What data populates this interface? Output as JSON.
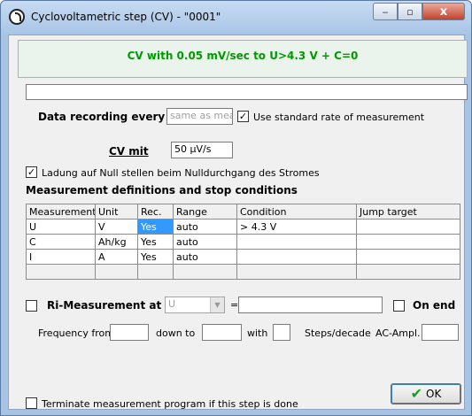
{
  "window": {
    "title": "Cyclovoltametric step (CV) - \"0001\"",
    "minimize_glyph": "‒",
    "maximize_glyph": "▫",
    "close_glyph": "x"
  },
  "banner": {
    "text": "CV with 0.05 mV/sec to U>4.3 V + C=0"
  },
  "recording": {
    "label": "Data recording every",
    "input_value": "same as meas",
    "std_rate_checkbox": "✓",
    "std_rate_label": "Use standard rate of measurement"
  },
  "cv": {
    "label": "CV mit",
    "value": "50 µV/s"
  },
  "ladung": {
    "checkbox": "✓",
    "label": "Ladung auf Null stellen beim Nulldurchgang des Stromes"
  },
  "definitions": {
    "heading": "Measurement definitions and stop conditions",
    "columns": [
      "Measurement u",
      "Unit",
      "Rec.",
      "Range",
      "Condition",
      "Jump target"
    ],
    "rows": [
      [
        "U",
        "V",
        "Yes",
        "auto",
        "> 4.3 V",
        ""
      ],
      [
        "C",
        "Ah/kg",
        "Yes",
        "auto",
        "",
        ""
      ],
      [
        "I",
        "A",
        "Yes",
        "auto",
        "",
        ""
      ],
      [
        "",
        "",
        "",
        "",
        "",
        ""
      ]
    ]
  },
  "ri": {
    "label": "Ri-Measurement at",
    "select_value": "U",
    "equals": "=",
    "on_end_label": "On end"
  },
  "frequency": {
    "from_label": "Frequency from",
    "down_to_label": "down to",
    "with_label": "with",
    "steps_label": "Steps/decade",
    "ac_label": "AC-Ampl."
  },
  "terminate": {
    "label": "Terminate measurement program if this step is done"
  },
  "ok_button": {
    "label": "OK"
  }
}
